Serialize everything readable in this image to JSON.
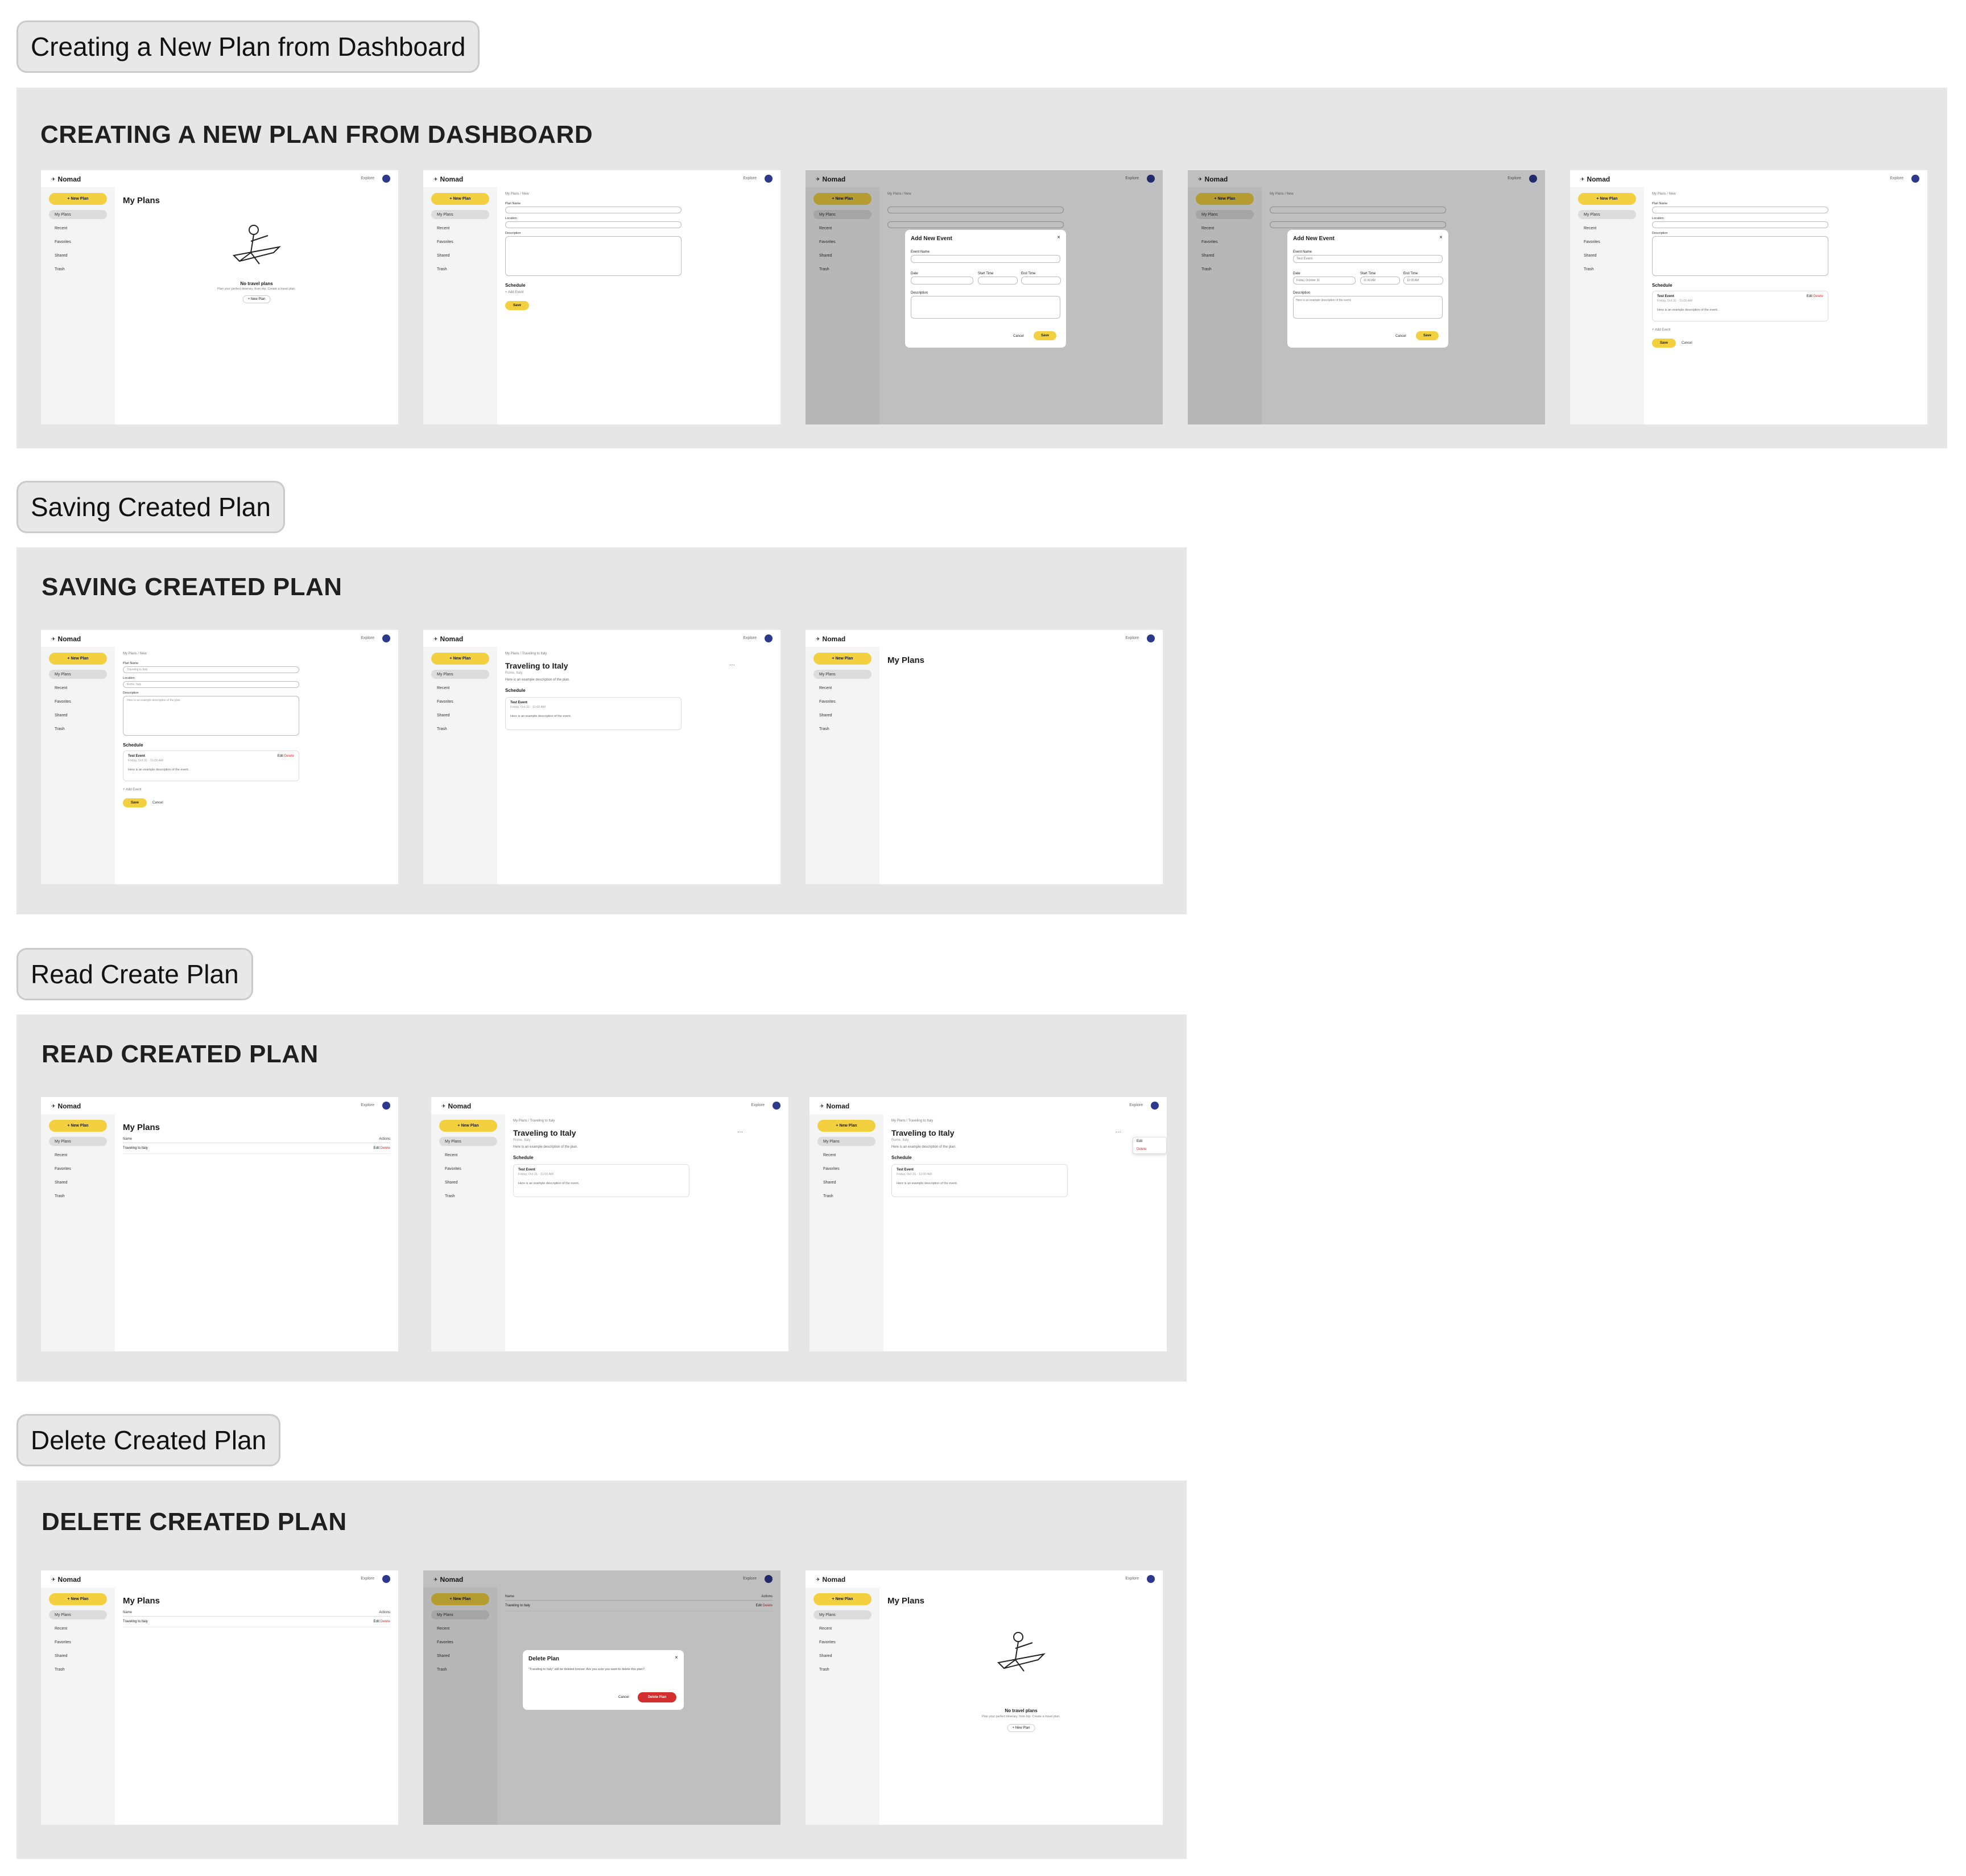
{
  "sections": {
    "s1": {
      "label": "Creating a New Plan from Dashboard",
      "title": "CREATING A NEW PLAN FROM DASHBOARD"
    },
    "s2": {
      "label": "Saving Created Plan",
      "title": "SAVING CREATED PLAN"
    },
    "s3": {
      "label": "Read Create Plan",
      "title": "READ CREATED PLAN"
    },
    "s4": {
      "label": "Delete Created Plan",
      "title": "DELETE CREATED PLAN"
    }
  },
  "app": {
    "logo": "Nomad",
    "explore": "Explore",
    "new_plan": "+ New Plan",
    "nav": [
      "My Plans",
      "Recent",
      "Favorites",
      "Shared",
      "Trash"
    ],
    "my_plans": "My Plans",
    "crumb_new": "My Plans  /  New",
    "crumb_italy": "My Plans  /  Traveling to Italy",
    "plan_name_label": "Plan Name",
    "location_label": "Location",
    "description_label": "Description",
    "schedule": "Schedule",
    "add_event": "+ Add Event",
    "save": "Save",
    "cancel": "Cancel",
    "no_plans": "No travel plans",
    "no_plans_sub": "Plan your perfect itinerary, from trip. Create a travel plan.",
    "new_plan_small": "+ New Plan",
    "add_new_event": "Add New Event",
    "event_name": "Event Name",
    "date": "Date",
    "start_time": "Start Time",
    "end_time": "End Time",
    "test_event": "Test Event",
    "event_date": "Friday, Oct 31 · 11:00 AM",
    "event_desc": "Here is an example description of the event.",
    "plan_title": "Traveling to Italy",
    "plan_loc": "Rome, Italy",
    "plan_desc": "Here is an example description of the plan.",
    "edit": "Edit",
    "delete": "Delete",
    "name_col": "Name",
    "actions_col": "Actions",
    "delete_plan": "Delete Plan",
    "delete_msg": "\"Traveling to Italy\" will be deleted forever. Are you sure you want to delete this plan?",
    "delete_plan_btn": "Delete Plan",
    "x": "×",
    "dots": "···",
    "date_val": "Friday, October 31",
    "start_val": "11:00 AM",
    "end_val": "12:00 AM"
  }
}
